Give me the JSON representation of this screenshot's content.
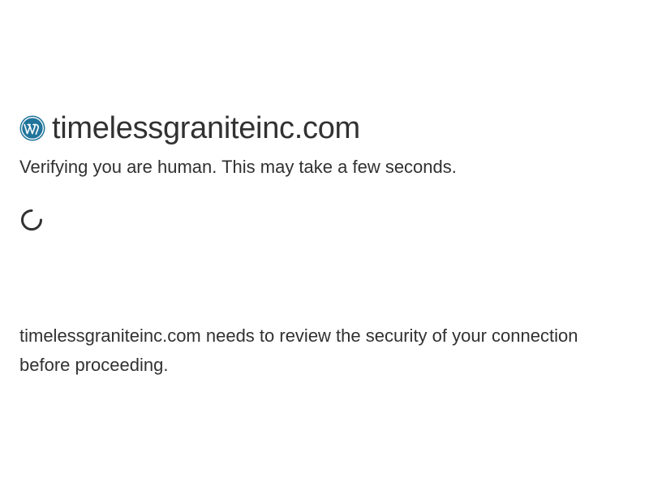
{
  "site": {
    "domain": "timelessgraniteinc.com",
    "icon": "wordpress-icon",
    "icon_color": "#21759b"
  },
  "status": {
    "verifying_text": "Verifying you are human. This may take a few seconds.",
    "spinner_icon": "loading-spinner-icon"
  },
  "security": {
    "message": "timelessgraniteinc.com needs to review the security of your connection before proceeding."
  },
  "colors": {
    "text": "#313131",
    "background": "#ffffff"
  }
}
